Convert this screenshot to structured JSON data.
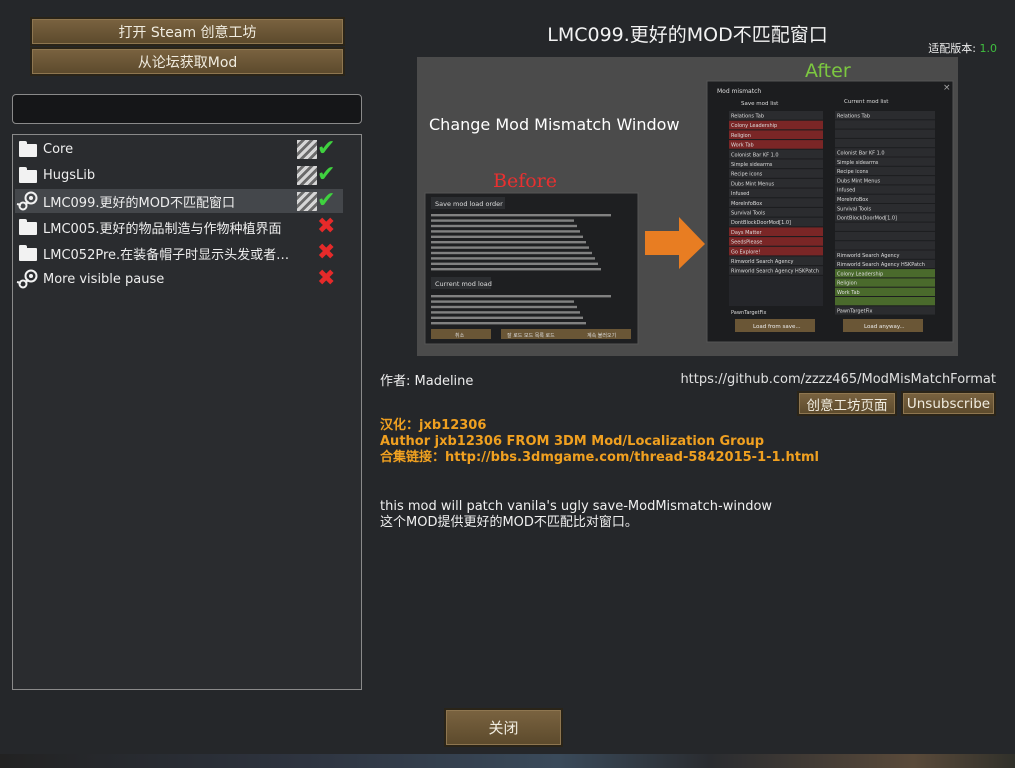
{
  "left_panel": {
    "open_workshop_label": "打开 Steam 创意工坊",
    "get_from_forum_label": "从论坛获取Mod",
    "search_value": "",
    "mods": [
      {
        "name": "Core",
        "source": "local",
        "status": "ok",
        "selected": false
      },
      {
        "name": "HugsLib",
        "source": "local",
        "status": "ok",
        "selected": false
      },
      {
        "name": "LMC099.更好的MOD不匹配窗口",
        "source": "steam",
        "status": "ok",
        "selected": true
      },
      {
        "name": "LMC005.更好的物品制造与作物种植界面",
        "source": "local",
        "status": "error",
        "selected": false
      },
      {
        "name": "LMC052Pre.在装备帽子时显示头发或者隐藏帽子",
        "source": "local",
        "status": "error",
        "selected": false
      },
      {
        "name": "More visible pause",
        "source": "steam",
        "status": "error",
        "selected": false
      }
    ]
  },
  "detail": {
    "title": "LMC099.更好的MOD不匹配窗口",
    "version_label": "适配版本:",
    "version_value": "1.0",
    "author": "作者: Madeline",
    "url": "https://github.com/zzzz465/ModMisMatchFormat",
    "workshop_page_label": "创意工坊页面",
    "unsubscribe_label": "Unsubscribe",
    "localization_lines": [
      "汉化：jxb12306",
      "Author jxb12306 FROM 3DM Mod/Localization Group",
      "合集链接：http://bbs.3dmgame.com/thread-5842015-1-1.html"
    ],
    "description_lines": [
      "this mod will patch vanila's ugly save-ModMismatch-window",
      "这个MOD提供更好的MOD不匹配比对窗口。"
    ]
  },
  "preview_image": {
    "headline": "Change Mod Mismatch Window",
    "before_label": "Before",
    "after_label": "After",
    "old_dialog": {
      "section1_title": "Save mod load order",
      "section2_title": "Current mod load",
      "buttons": [
        "취소",
        "잘 로드 모드 목록 로드",
        "계속 불러오기"
      ]
    },
    "new_dialog": {
      "title": "Mod mismatch",
      "save_col_title": "Save mod list",
      "current_col_title": "Current mod list",
      "save_list": [
        "Relations Tab",
        "Colony Leadership",
        "Religion",
        "Work Tab",
        "Colonist Bar KF 1.0",
        "Simple sidearms",
        "Recipe icons",
        "Dubs Mint Menus",
        "Infused",
        "MoreInfoBox",
        "Survival Tools",
        "DontBlockDoorMod[1.0]",
        "Days Matter",
        "SeedsPlease",
        "Go Explore!",
        "Rimworld Search Agency",
        "Rimworld Search Agency HSKPatch"
      ],
      "save_list_red": [
        1,
        2,
        3,
        12,
        13,
        14
      ],
      "current_list": [
        "Relations Tab",
        "",
        "",
        "",
        "Colonist Bar KF 1.0",
        "Simple sidearms",
        "Recipe icons",
        "Dubs Mint Menus",
        "Infused",
        "MoreInfoBox",
        "Survival Tools",
        "DontBlockDoorMod[1.0]",
        "",
        "",
        "",
        "Rimworld Search Agency",
        "Rimworld Search Agency HSKPatch",
        "Colony Leadership",
        "Religion",
        "Work Tab",
        "",
        "PawnTargetFix"
      ],
      "current_list_green": [
        17,
        18,
        19,
        20
      ],
      "save_extra": "PawnTargetFix",
      "load_from_save_label": "Load from save...",
      "load_anyway_label": "Load anyway..."
    }
  },
  "footer": {
    "close_label": "关闭"
  },
  "colors": {
    "ok": "#3fd23f",
    "error": "#e62a2a",
    "localization_text": "#f0a020",
    "version_text": "#3fbf3f"
  }
}
